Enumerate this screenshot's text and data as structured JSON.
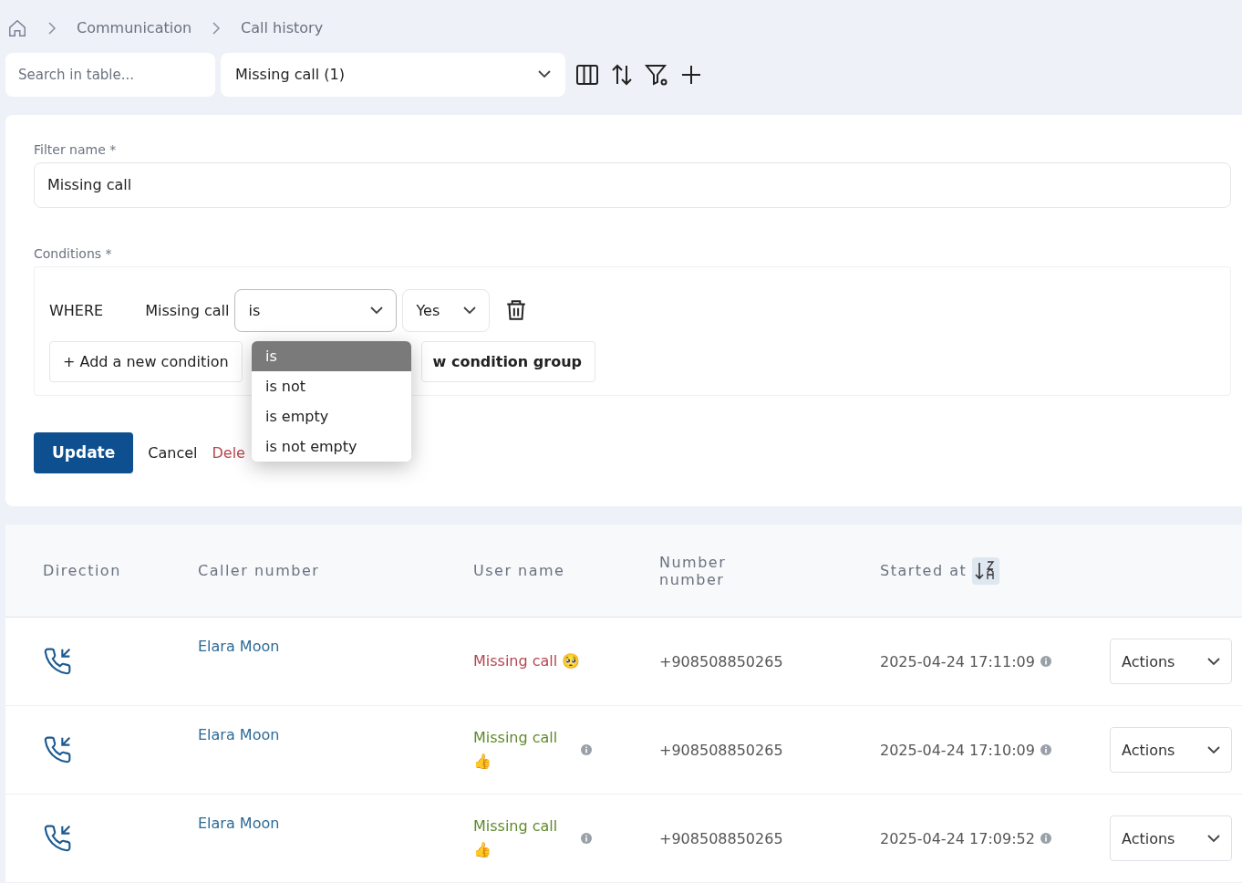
{
  "breadcrumb": [
    "Communication",
    "Call history"
  ],
  "toolbar": {
    "search": {
      "placeholder": "Search in table..."
    },
    "filter_select": {
      "value": "Missing call (1)"
    }
  },
  "filter_form": {
    "name_label": "Filter name *",
    "name_value": "Missing call",
    "conditions_label": "Conditions *",
    "condition": {
      "where": "WHERE",
      "field": "Missing call",
      "operator": "is",
      "value": "Yes"
    },
    "operator_menu": [
      {
        "label": "is",
        "selected": true
      },
      {
        "label": "is not",
        "selected": false
      },
      {
        "label": "is empty",
        "selected": false
      },
      {
        "label": "is not empty",
        "selected": false
      }
    ],
    "add_condition": "+ Add a new condition",
    "add_group": "w condition group",
    "update": "Update",
    "cancel": "Cancel",
    "delete": "Dele"
  },
  "table": {
    "columns": [
      "Direction",
      "Caller number",
      "User name",
      "Number number",
      "Started at"
    ],
    "rows": [
      {
        "caller": "Elara Moon",
        "status": "Missing call",
        "emoji": "🥺",
        "color": "#b5454f",
        "status_info": false,
        "number": "+908508850265",
        "started": "2025-04-24 17:11:09",
        "action": "Actions"
      },
      {
        "caller": "Elara Moon",
        "status": "Missing call",
        "emoji": "👍",
        "color": "#5e8a2c",
        "status_info": true,
        "number": "+908508850265",
        "started": "2025-04-24 17:10:09",
        "action": "Actions"
      },
      {
        "caller": "Elara Moon",
        "status": "Missing call",
        "emoji": "👍",
        "color": "#5e8a2c",
        "status_info": true,
        "number": "+908508850265",
        "started": "2025-04-24 17:09:52",
        "action": "Actions"
      }
    ]
  }
}
